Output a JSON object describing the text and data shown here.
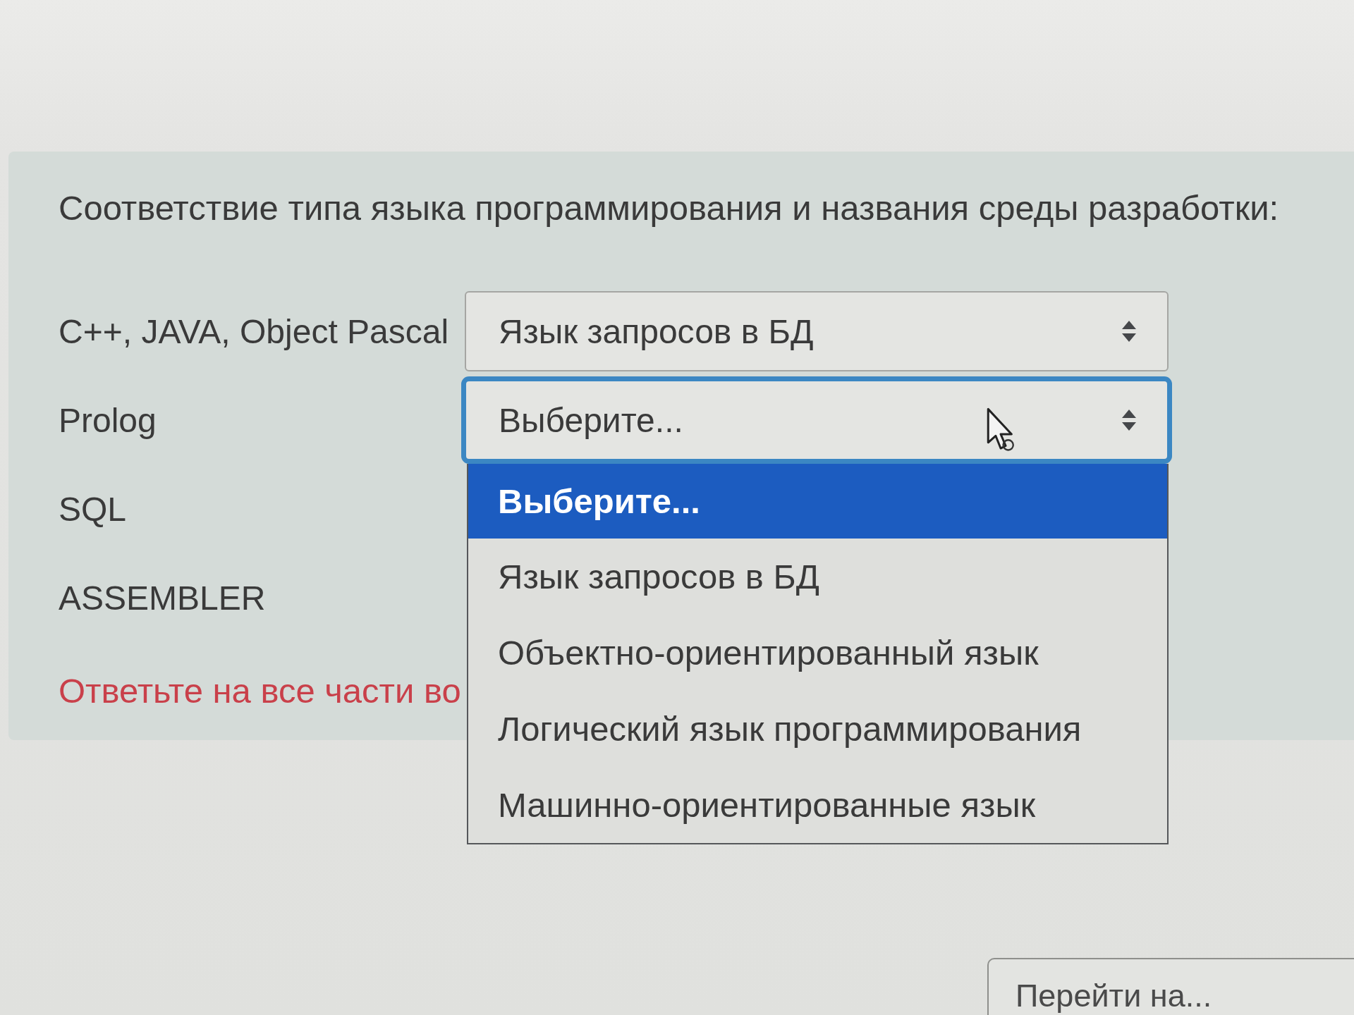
{
  "question": {
    "text": "Соответствие типа языка программирования и названия среды разработки:"
  },
  "rows": [
    {
      "label": "C++, JAVA, Object Pascal",
      "select": {
        "value": "Язык запросов в БД",
        "focused": false
      }
    },
    {
      "label": "Prolog",
      "select": {
        "value": "Выберите...",
        "focused": true,
        "expanded": true,
        "options": [
          {
            "label": "Выберите...",
            "selected": true
          },
          {
            "label": "Язык запросов в БД",
            "selected": false
          },
          {
            "label": "Объектно-ориентированный язык",
            "selected": false
          },
          {
            "label": "Логический язык программирования",
            "selected": false
          },
          {
            "label": "Машинно-ориентированные язык",
            "selected": false
          }
        ]
      }
    },
    {
      "label": "SQL"
    },
    {
      "label": "ASSEMBLER"
    }
  ],
  "error": "Ответьте на все части во",
  "jump_select": {
    "value": "Перейти на..."
  }
}
